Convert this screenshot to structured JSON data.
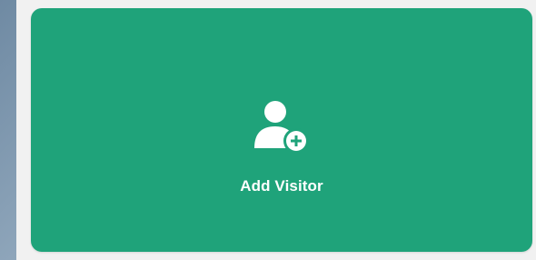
{
  "card": {
    "label": "Add Visitor",
    "icon": "user-plus-icon",
    "background_color": "#1fa37a",
    "text_color": "#ffffff"
  }
}
